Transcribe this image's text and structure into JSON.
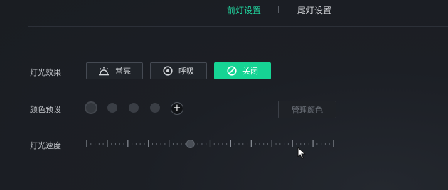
{
  "tabs": [
    {
      "label": "前灯设置",
      "active": true
    },
    {
      "label": "尾灯设置",
      "active": false
    }
  ],
  "effect": {
    "label": "灯光效果",
    "options": [
      {
        "label": "常亮",
        "icon": "sun-rise-icon",
        "active": false
      },
      {
        "label": "呼吸",
        "icon": "breath-circle-icon",
        "active": false
      },
      {
        "label": "关闭",
        "icon": "off-slash-icon",
        "active": true
      }
    ]
  },
  "color_preset": {
    "label": "颜色预设",
    "manage_label": "管理颜色",
    "add_icon": "+"
  },
  "speed": {
    "label": "灯光速度",
    "value_fraction": 0.42
  },
  "colors": {
    "accent": "#16d494",
    "tab_active": "#21d69f",
    "background": "#1c1f25"
  }
}
